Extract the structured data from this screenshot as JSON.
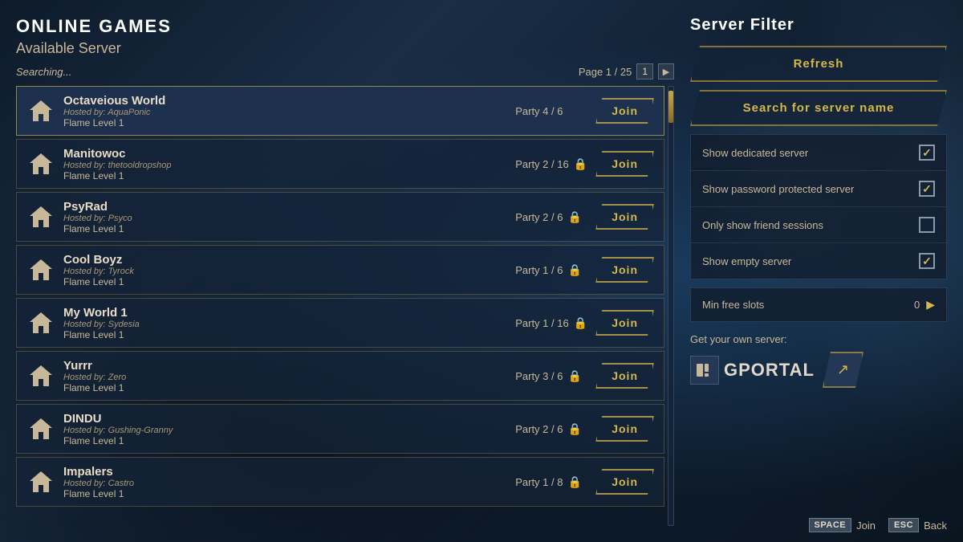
{
  "header": {
    "title": "ONLINE GAMES",
    "subtitle": "Available Server",
    "searching": "Searching...",
    "page_label": "Page 1 / 25",
    "page_current": "1",
    "page_total": "25"
  },
  "servers": [
    {
      "id": 1,
      "name": "Octaveious World",
      "host_label": "Hosted by:",
      "host": "AquaPonic",
      "level": "Flame Level 1",
      "party": "Party 4 / 6",
      "locked": false,
      "highlighted": true,
      "join_label": "Join"
    },
    {
      "id": 2,
      "name": "Manitowoc",
      "host_label": "Hosted by:",
      "host": "thetooldropshop",
      "level": "Flame Level 1",
      "party": "Party 2 / 16",
      "locked": true,
      "highlighted": false,
      "join_label": "Join"
    },
    {
      "id": 3,
      "name": "PsyRad",
      "host_label": "Hosted by:",
      "host": "Psyco",
      "level": "Flame Level 1",
      "party": "Party 2 / 6",
      "locked": true,
      "highlighted": false,
      "join_label": "Join"
    },
    {
      "id": 4,
      "name": "Cool Boyz",
      "host_label": "Hosted by:",
      "host": "Tyrock",
      "level": "Flame Level 1",
      "party": "Party 1 / 6",
      "locked": true,
      "highlighted": false,
      "join_label": "Join"
    },
    {
      "id": 5,
      "name": "My World 1",
      "host_label": "Hosted by:",
      "host": "Sydesia",
      "level": "Flame Level 1",
      "party": "Party 1 / 16",
      "locked": true,
      "highlighted": false,
      "join_label": "Join"
    },
    {
      "id": 6,
      "name": "Yurrr",
      "host_label": "Hosted by:",
      "host": "Zero",
      "level": "Flame Level 1",
      "party": "Party 3 / 6",
      "locked": true,
      "highlighted": false,
      "join_label": "Join"
    },
    {
      "id": 7,
      "name": "DINDU",
      "host_label": "Hosted by:",
      "host": "Gushing-Granny",
      "level": "Flame Level 1",
      "party": "Party 2 / 6",
      "locked": true,
      "highlighted": false,
      "join_label": "Join"
    },
    {
      "id": 8,
      "name": "Impalers",
      "host_label": "Hosted by:",
      "host": "Castro",
      "level": "Flame Level 1",
      "party": "Party 1 / 8",
      "locked": true,
      "highlighted": false,
      "join_label": "Join"
    }
  ],
  "filter": {
    "title": "Server Filter",
    "refresh_label": "Refresh",
    "search_label": "Search for server name",
    "options": [
      {
        "label": "Show dedicated server",
        "checked": true
      },
      {
        "label": "Show password protected server",
        "checked": true
      },
      {
        "label": "Only show friend sessions",
        "checked": false
      },
      {
        "label": "Show empty server",
        "checked": true
      }
    ],
    "min_slots_label": "Min free slots",
    "min_slots_value": "0"
  },
  "gportal": {
    "text": "Get your own server:",
    "name": "GPORTAL",
    "link_icon": "↗"
  },
  "hints": [
    {
      "key": "SPACE",
      "label": "Join"
    },
    {
      "key": "ESC",
      "label": "Back"
    }
  ]
}
